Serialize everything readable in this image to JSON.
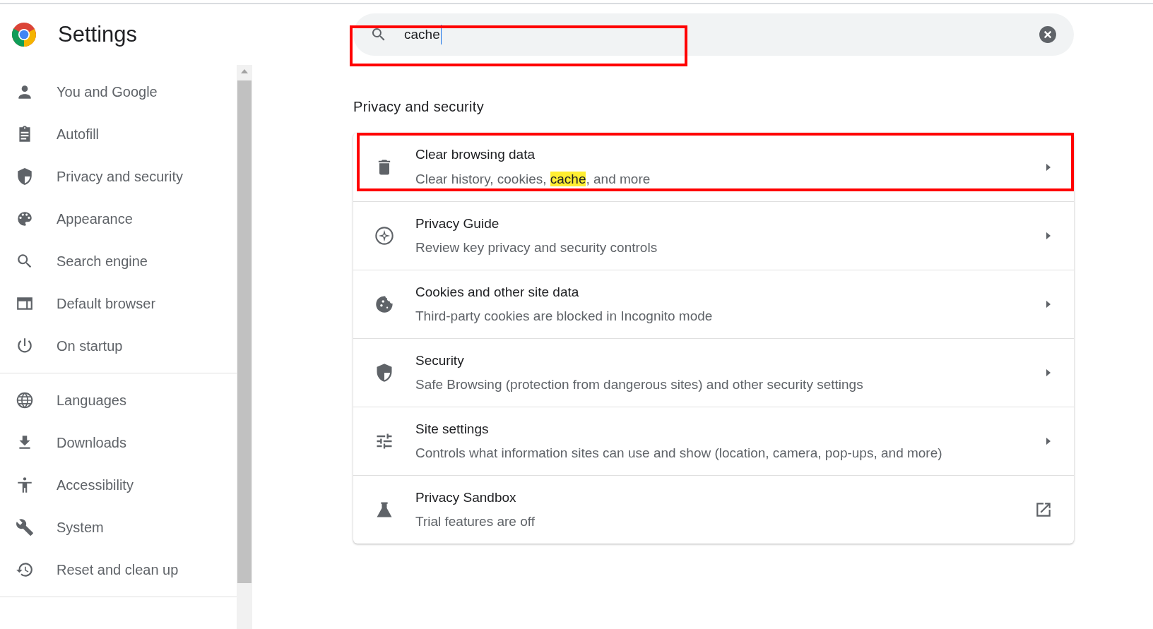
{
  "header": {
    "title": "Settings"
  },
  "sidebar": {
    "groups": [
      {
        "items": [
          {
            "label": "You and Google",
            "kind": "person"
          },
          {
            "label": "Autofill",
            "kind": "clipboard"
          },
          {
            "label": "Privacy and security",
            "kind": "shield"
          },
          {
            "label": "Appearance",
            "kind": "palette"
          },
          {
            "label": "Search engine",
            "kind": "search"
          },
          {
            "label": "Default browser",
            "kind": "browser"
          },
          {
            "label": "On startup",
            "kind": "power"
          }
        ]
      },
      {
        "items": [
          {
            "label": "Languages",
            "kind": "globe"
          },
          {
            "label": "Downloads",
            "kind": "download"
          },
          {
            "label": "Accessibility",
            "kind": "accessibility"
          },
          {
            "label": "System",
            "kind": "wrench"
          },
          {
            "label": "Reset and clean up",
            "kind": "history"
          }
        ]
      }
    ]
  },
  "search": {
    "value": "cache",
    "outlined": true
  },
  "section": {
    "title": "Privacy and security",
    "rows": [
      {
        "title": "Clear browsing data",
        "subtitle": [
          {
            "text": "Clear history, cookies, ",
            "highlighted": false
          },
          {
            "text": "cache",
            "highlighted": true
          },
          {
            "text": ", and more",
            "highlighted": false
          }
        ],
        "kind": "trash",
        "external": false,
        "outlined": true
      },
      {
        "title": "Privacy Guide",
        "subtitle": [
          {
            "text": "Review key privacy and security controls",
            "highlighted": false
          }
        ],
        "kind": "compass",
        "external": false,
        "outlined": false
      },
      {
        "title": "Cookies and other site data",
        "subtitle": [
          {
            "text": "Third-party cookies are blocked in Incognito mode",
            "highlighted": false
          }
        ],
        "kind": "cookie",
        "external": false,
        "outlined": false
      },
      {
        "title": "Security",
        "subtitle": [
          {
            "text": "Safe Browsing (protection from dangerous sites) and other security settings",
            "highlighted": false
          }
        ],
        "kind": "shield",
        "external": false,
        "outlined": false
      },
      {
        "title": "Site settings",
        "subtitle": [
          {
            "text": "Controls what information sites can use and show (location, camera, pop-ups, and more)",
            "highlighted": false
          }
        ],
        "kind": "sliders",
        "external": false,
        "outlined": false
      },
      {
        "title": "Privacy Sandbox",
        "subtitle": [
          {
            "text": "Trial features are off",
            "highlighted": false
          }
        ],
        "kind": "flask",
        "external": true,
        "outlined": false
      }
    ]
  }
}
